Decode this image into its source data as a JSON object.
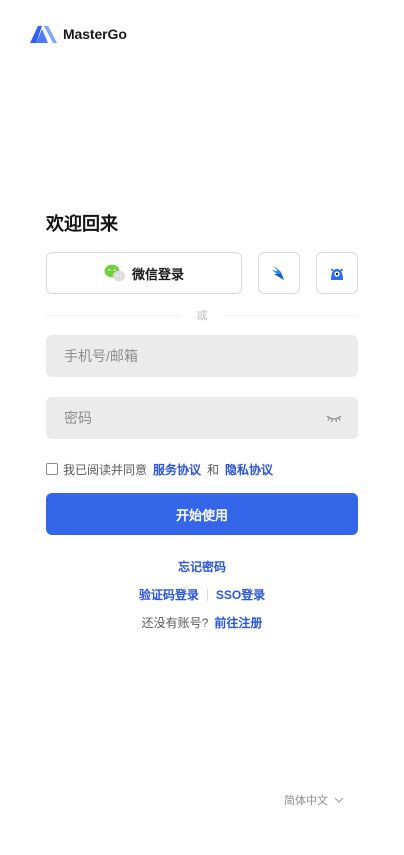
{
  "brand": {
    "name": "MasterGo"
  },
  "login": {
    "title": "欢迎回来",
    "wechat_label": "微信登录",
    "divider_text": "或",
    "account_placeholder": "手机号/邮箱",
    "password_placeholder": "密码",
    "agree_text": "我已阅读并同意",
    "terms_label": "服务协议",
    "and_text": "和",
    "privacy_label": "隐私协议",
    "submit_label": "开始使用",
    "forgot_label": "忘记密码",
    "code_login_label": "验证码登录",
    "sso_login_label": "SSO登录",
    "no_account_text": "还没有账号?",
    "register_label": "前往注册"
  },
  "footer": {
    "language": "简体中文"
  },
  "colors": {
    "primary": "#3566ea",
    "link": "#2b55d6",
    "input_bg": "#ebebeb"
  },
  "icons": [
    "mastergo-logo-icon",
    "wechat-icon",
    "feishu-icon",
    "lanhu-icon",
    "eye-closed-icon",
    "chevron-down-icon"
  ]
}
